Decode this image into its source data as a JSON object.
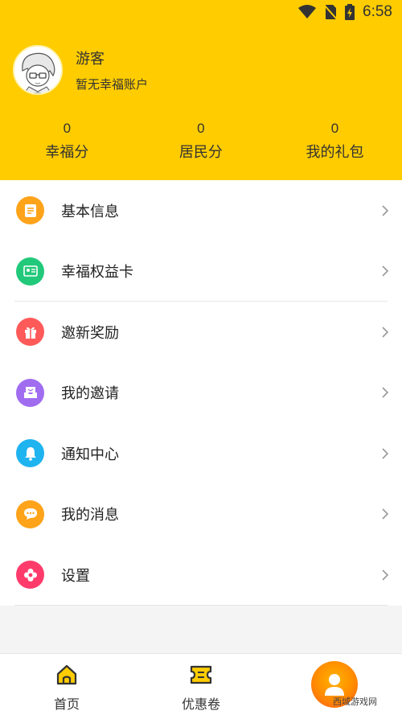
{
  "status_bar": {
    "time": "6:58"
  },
  "profile": {
    "name": "游客",
    "subtitle": "暂无幸福账户"
  },
  "stats": [
    {
      "value": "0",
      "label": "幸福分"
    },
    {
      "value": "0",
      "label": "居民分"
    },
    {
      "value": "0",
      "label": "我的礼包"
    }
  ],
  "menu": [
    {
      "label": "基本信息",
      "icon": "document-icon",
      "color": "#ffa31a"
    },
    {
      "label": "幸福权益卡",
      "icon": "card-icon",
      "color": "#22c97a"
    },
    {
      "label": "邀新奖励",
      "icon": "gift-icon",
      "color": "#ff5a5a"
    },
    {
      "label": "我的邀请",
      "icon": "inbox-icon",
      "color": "#a06cf0"
    },
    {
      "label": "通知中心",
      "icon": "bell-icon",
      "color": "#1fb3f0"
    },
    {
      "label": "我的消息",
      "icon": "chat-icon",
      "color": "#ffa31a"
    },
    {
      "label": "设置",
      "icon": "flower-icon",
      "color": "#ff3b6b"
    }
  ],
  "tabbar": [
    {
      "label": "首页",
      "icon": "home-icon"
    },
    {
      "label": "优惠卷",
      "icon": "coupon-icon"
    }
  ],
  "accent": "#ffcc00",
  "watermark": "西域游戏网"
}
